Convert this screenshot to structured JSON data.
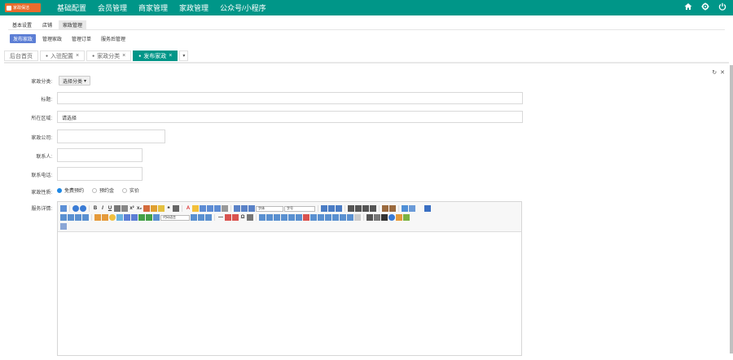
{
  "header": {
    "logo_text": "家政保洁",
    "nav": [
      "基础配置",
      "会员管理",
      "商家管理",
      "家政管理",
      "公众号/小程序"
    ]
  },
  "subtabs": [
    "基本设置",
    "店铺",
    "家政管理"
  ],
  "menu": [
    "发布家政",
    "管理家政",
    "管理订单",
    "服务后管理"
  ],
  "page_tabs": {
    "home": "后台首页",
    "items": [
      "入驻配置",
      "家政分类",
      "发布家政"
    ]
  },
  "form": {
    "category_label": "家政分类:",
    "category_button": "选择分类",
    "title_label": "标题:",
    "title_value": "",
    "area_label": "所在区域:",
    "area_value": "请选择",
    "company_label": "家政公司:",
    "company_value": "",
    "contact_label": "联系人:",
    "contact_value": "",
    "phone_label": "联系电话:",
    "phone_value": "",
    "nature_label": "家政性质:",
    "nature_options": [
      "免费预约",
      "预约金",
      "实价"
    ],
    "detail_label": "服务详情:"
  },
  "editor": {
    "font_family_placeholder": "字体",
    "font_size_placeholder": "字号",
    "code_lang_placeholder": "代码语言"
  },
  "colors": {
    "primary": "#009688",
    "accent": "#5c7ed5",
    "radio": "#1e88e5"
  }
}
